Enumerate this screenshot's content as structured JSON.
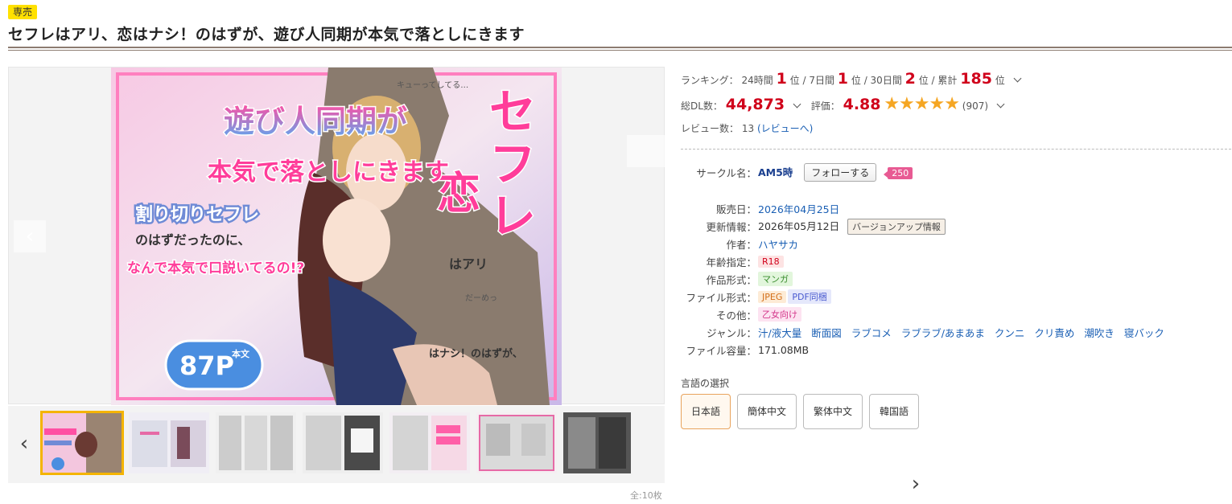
{
  "header": {
    "badge": "専売",
    "title": "セフレはアリ、恋はナシ！のはずが、遊び人同期が本気で落としにきます"
  },
  "gallery": {
    "total": "全:10枚",
    "cover": {
      "title_chars": [
        "セ",
        "フ",
        "レ"
      ],
      "koi": "恋",
      "ari": "はアリ",
      "nashi": "はナシ！のはずが、",
      "main_big": "遊び人同期が",
      "main_line2": "本気で落としにきます",
      "sub1": "割り切りセフレ",
      "sub2": "のはずだったのに、",
      "sub3": "なんで本気で口説いてるの!?",
      "pages": "87P",
      "pages_label": "本文",
      "bubble1": "キューってしてる…",
      "bubble2": "だーめっ"
    },
    "thumb_count": 7
  },
  "ranking": {
    "label": "ランキング：",
    "items": [
      {
        "period": "24時間",
        "rank": "1",
        "suffix": "位"
      },
      {
        "period": "7日間",
        "rank": "1",
        "suffix": "位"
      },
      {
        "period": "30日間",
        "rank": "2",
        "suffix": "位"
      },
      {
        "period": "累計",
        "rank": "185",
        "suffix": "位"
      }
    ]
  },
  "stats": {
    "dl_label": "総DL数：",
    "dl_value": "44,873",
    "rating_label": "評価：",
    "rating_value": "4.88",
    "stars": "★★★★★",
    "rating_count": "(907)",
    "review_label": "レビュー数：",
    "review_count": "13",
    "review_link": "(レビューへ)"
  },
  "info": {
    "circle_label": "サークル名：",
    "circle_name": "AM5時",
    "follow_label": "フォローする",
    "follow_count": "250",
    "release_label": "販売日：",
    "release_date": "2026年04月25日",
    "update_label": "更新情報：",
    "update_date": "2026年05月12日",
    "update_tag": "バージョンアップ情報",
    "author_label": "作者：",
    "author": "ハヤサカ",
    "age_label": "年齢指定：",
    "age": "R18",
    "format_label": "作品形式：",
    "format": "マンガ",
    "file_label": "ファイル形式：",
    "file_jpeg": "JPEG",
    "file_pdf": "PDF同梱",
    "other_label": "その他：",
    "other": "乙女向け",
    "genre_label": "ジャンル：",
    "genres": [
      "汁/液大量",
      "断面図",
      "ラブコメ",
      "ラブラブ/あまあま",
      "クンニ",
      "クリ責め",
      "潮吹き",
      "寝バック"
    ],
    "size_label": "ファイル容量：",
    "size": "171.08MB"
  },
  "language": {
    "title": "言語の選択",
    "options": [
      "日本語",
      "簡体中文",
      "繁体中文",
      "韓国語"
    ],
    "selected": "日本語"
  },
  "colors": {
    "accent_red": "#d0021b",
    "badge_yellow": "#ffe100",
    "link_blue": "#1a5fb4",
    "follow_pink": "#e85a93",
    "star_gold": "#f5a623"
  }
}
